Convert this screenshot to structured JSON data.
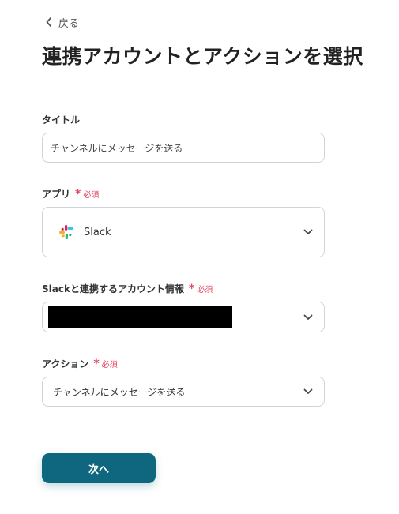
{
  "header": {
    "back_label": "戻る",
    "title": "連携アカウントとアクションを選択"
  },
  "form": {
    "title_field": {
      "label": "タイトル",
      "value": "チャンネルにメッセージを送る"
    },
    "app_field": {
      "label": "アプリ",
      "required_mark": "*",
      "required_text": "必須",
      "value": "Slack",
      "icon": "slack-logo"
    },
    "account_field": {
      "label": "Slackと連携するアカウント情報",
      "required_mark": "*",
      "required_text": "必須",
      "value_redacted": true
    },
    "action_field": {
      "label": "アクション",
      "required_mark": "*",
      "required_text": "必須",
      "value": "チャンネルにメッセージを送る"
    }
  },
  "footer": {
    "next_label": "次へ"
  },
  "colors": {
    "primary_button": "#0e677f",
    "required": "#e2405c",
    "border": "#cfd4da"
  }
}
